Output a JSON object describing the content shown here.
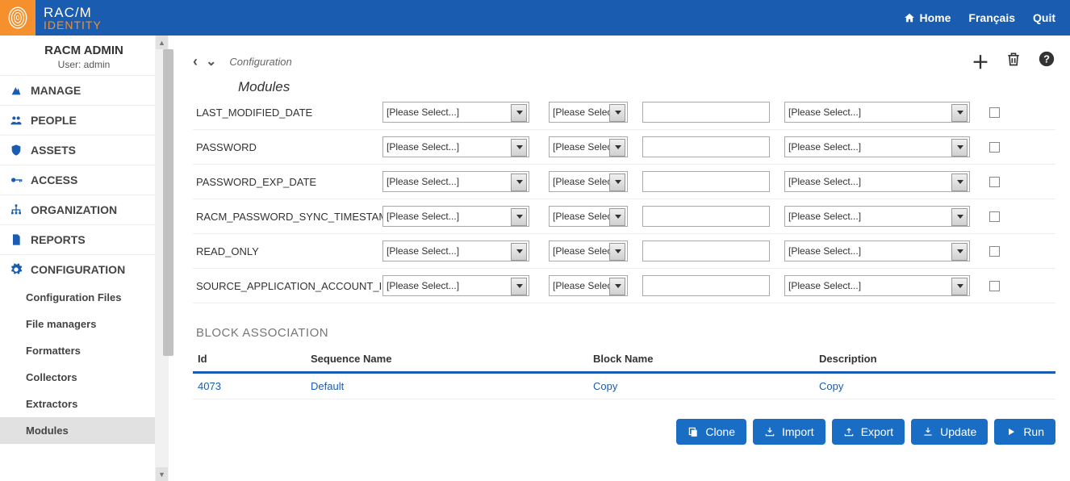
{
  "brand": {
    "top": "RAC/M",
    "bottom": "IDENTITY"
  },
  "topnav": {
    "home": "Home",
    "lang": "Français",
    "quit": "Quit"
  },
  "sidebar": {
    "title": "RACM ADMIN",
    "user_line": "User: admin",
    "items": [
      {
        "label": "MANAGE"
      },
      {
        "label": "PEOPLE"
      },
      {
        "label": "ASSETS"
      },
      {
        "label": "ACCESS"
      },
      {
        "label": "ORGANIZATION"
      },
      {
        "label": "REPORTS"
      },
      {
        "label": "CONFIGURATION"
      }
    ],
    "sub": [
      {
        "label": "Configuration Files"
      },
      {
        "label": "File managers"
      },
      {
        "label": "Formatters"
      },
      {
        "label": "Collectors"
      },
      {
        "label": "Extractors"
      },
      {
        "label": "Modules",
        "active": true
      }
    ]
  },
  "page": {
    "breadcrumb": "Configuration",
    "title": "Modules"
  },
  "select_ph": "[Please Select...]",
  "select_ph_short": "[Please Selec",
  "attrs": [
    "LAST_MODIFIED_DATE",
    "PASSWORD",
    "PASSWORD_EXP_DATE",
    "RACM_PASSWORD_SYNC_TIMESTAMP",
    "READ_ONLY",
    "SOURCE_APPLICATION_ACCOUNT_ID"
  ],
  "block_section": "BLOCK ASSOCIATION",
  "block_table": {
    "headers": [
      "Id",
      "Sequence Name",
      "Block Name",
      "Description"
    ],
    "row": {
      "id": "4073",
      "seq": "Default",
      "block": "Copy",
      "desc": "Copy"
    }
  },
  "buttons": {
    "clone": "Clone",
    "import": "Import",
    "export": "Export",
    "update": "Update",
    "run": "Run"
  }
}
